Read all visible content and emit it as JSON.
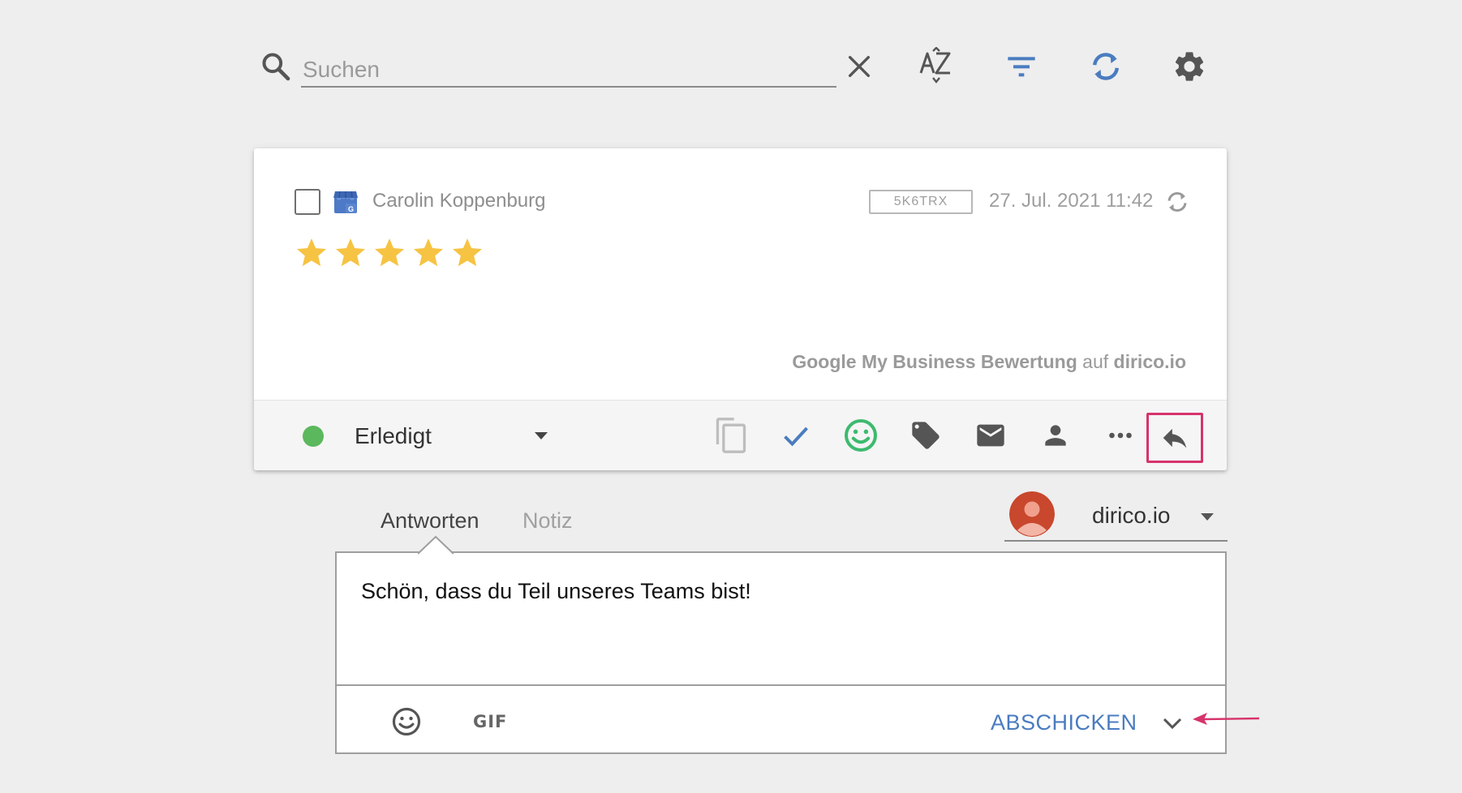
{
  "search": {
    "placeholder": "Suchen"
  },
  "toolbar": {
    "clear_icon": "close-icon",
    "sort_icon": "sort-az-icon",
    "filter_icon": "filter-icon",
    "refresh_icon": "refresh-icon",
    "settings_icon": "gear-icon",
    "accent_color": "#4a7cc0"
  },
  "review": {
    "reviewer_name": "Carolin Koppenburg",
    "source_icon": "google-my-business-icon",
    "id": "5K6TRX",
    "date": "27. Jul. 2021 11:42",
    "rating": 5,
    "rating_max": 5,
    "star_color": "#f6c343",
    "source_platform": "Google My Business Bewertung",
    "source_connector": "auf",
    "source_site": "dirico.io"
  },
  "status": {
    "label": "Erledigt",
    "dot_color": "#5cb85c"
  },
  "actions": [
    "copy-icon",
    "check-icon",
    "emoji-icon",
    "tag-icon",
    "mail-icon",
    "person-icon",
    "more-icon",
    "reply-icon"
  ],
  "reply": {
    "tabs": [
      {
        "label": "Antworten",
        "active": true
      },
      {
        "label": "Notiz",
        "active": false
      }
    ],
    "account_name": "dirico.io",
    "message": "Schön, dass du Teil unseres Teams bist!",
    "gif_label": "GIF",
    "send_label": "ABSCHICKEN"
  },
  "highlight_color": "#d6336c"
}
